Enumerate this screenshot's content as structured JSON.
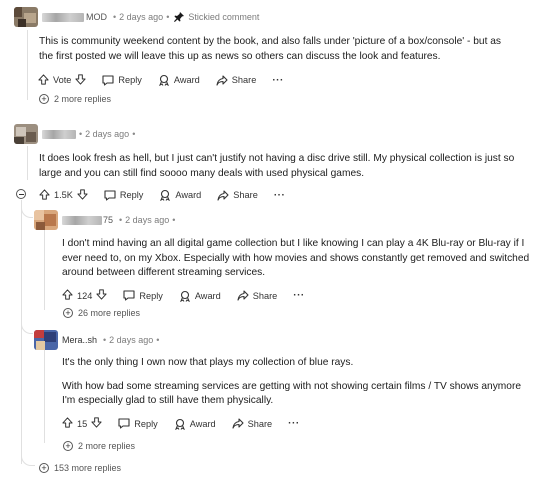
{
  "comments": [
    {
      "id": "c1",
      "username_visible": "MOD",
      "time": "2 days ago",
      "stickied_label": "Stickied comment",
      "body": [
        "This is community weekend content by the book, and also falls under 'picture of a box/console' - but as the first posted we will leave this up as news so others can discuss the look and features."
      ],
      "vote_label": "Vote",
      "reply_label": "Reply",
      "award_label": "Award",
      "share_label": "Share",
      "more_replies": "2 more replies"
    },
    {
      "id": "c2",
      "time": "2 days ago",
      "body": [
        "It does look fresh as hell, but I just can't justify not having a disc drive still. My physical collection is just so large and you can still find soooo many deals with used physical games."
      ],
      "score": "1.5K",
      "reply_label": "Reply",
      "award_label": "Award",
      "share_label": "Share"
    },
    {
      "id": "c3",
      "username_visible": "75",
      "time": "2 days ago",
      "body": [
        "I don't mind having an all digital game collection but I like knowing I can play a 4K Blu-ray or Blu-ray if I ever need to, on my Xbox. Especially with how movies and shows constantly get removed and switched around between different streaming services."
      ],
      "score": "124",
      "reply_label": "Reply",
      "award_label": "Award",
      "share_label": "Share",
      "more_replies": "26 more replies"
    },
    {
      "id": "c4",
      "username_visible": "Mera..sh",
      "time": "2 days ago",
      "body": [
        "It's the only thing I own now that plays my collection of blue rays.",
        "With how bad some streaming services are getting with not showing certain films / TV shows anymore I'm especially glad to still have them physically."
      ],
      "score": "15",
      "reply_label": "Reply",
      "award_label": "Award",
      "share_label": "Share",
      "more_replies": "2 more replies"
    }
  ],
  "thread_more_replies": "153 more replies",
  "icons": [
    "pin-icon",
    "upvote-icon",
    "downvote-icon",
    "reply-icon",
    "award-icon",
    "share-icon",
    "more-icon",
    "expand-icon",
    "collapse-icon"
  ],
  "colors": {
    "text": "#1c1c1c",
    "meta": "#7c7c7c",
    "line": "#e0e0e0"
  }
}
